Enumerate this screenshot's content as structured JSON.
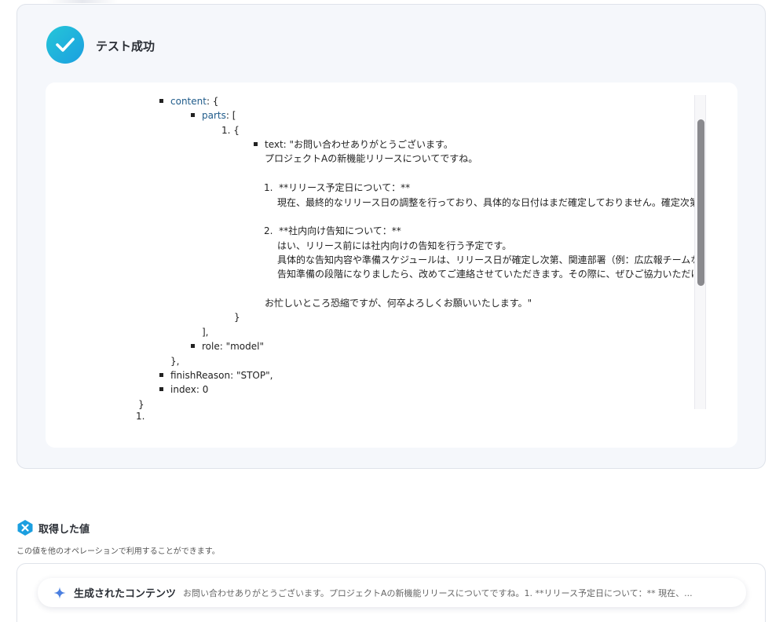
{
  "result": {
    "status_title": "テスト成功"
  },
  "json_view": {
    "content_key": "content",
    "content_rest": ": {",
    "parts_key": "parts",
    "parts_rest": ": [",
    "item_open": "1. {",
    "text_line": "text: \"お問い合わせありがとうございます。",
    "body_line_1": "プロジェクトAの新機能リリースについてですね。",
    "list_1_title": "1.  **リリース予定日について：**",
    "list_1_body": "現在、最終的なリリース日の調整を行っており、具体的な日付はまだ確定しておりません。確定次第、",
    "list_2_title": "2.  **社内向け告知について：**",
    "list_2_body_1": "はい、リリース前には社内向けの告知を行う予定です。",
    "list_2_body_2": "具体的な告知内容や準備スケジュールは、リリース日が確定し次第、関連部署（例：広広報チームな",
    "list_2_body_3": "告知準備の段階になりましたら、改めてご連絡させていただきます。その際に、ぜひご協力いただけれ",
    "closing_line": "お忙しいところ恐縮ですが、何卒よろしくお願いいたします。\"",
    "item_close": "}",
    "parts_close": "],",
    "role_line": "role: \"model\"",
    "content_close": "},",
    "finish_reason_line": "finishReason: \"STOP\",",
    "index_line": "index: 0",
    "object_close": "}",
    "tail_item": "1."
  },
  "values": {
    "title": "取得した値",
    "description": "この値を他のオペレーションで利用することができます。",
    "items": [
      {
        "label": "生成されたコンテンツ",
        "value": "お問い合わせありがとうございます。プロジェクトAの新機能リリースについてですね。1. **リリース予定日について：** 現在、..."
      }
    ]
  },
  "colors": {
    "success_gradient_start": "#25c6d8",
    "success_gradient_end": "#1b9fe0",
    "accent_blue": "#1b9fe0",
    "json_key": "#1f5b8a"
  }
}
